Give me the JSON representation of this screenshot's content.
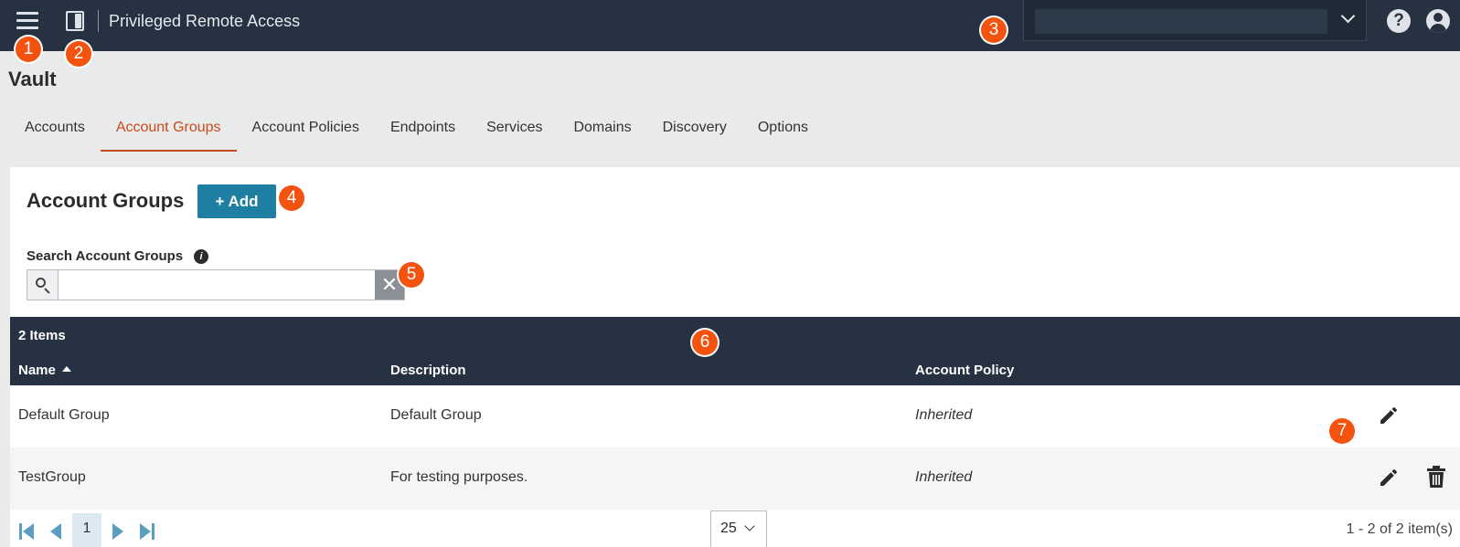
{
  "header": {
    "app_title": "Privileged Remote Access",
    "icons": [
      "hamburger-icon",
      "app-icon",
      "chevron-down-icon",
      "help-icon",
      "user-icon"
    ]
  },
  "page": {
    "title": "Vault"
  },
  "tabs": [
    {
      "label": "Accounts",
      "active": false
    },
    {
      "label": "Account Groups",
      "active": true
    },
    {
      "label": "Account Policies",
      "active": false
    },
    {
      "label": "Endpoints",
      "active": false
    },
    {
      "label": "Services",
      "active": false
    },
    {
      "label": "Domains",
      "active": false
    },
    {
      "label": "Discovery",
      "active": false
    },
    {
      "label": "Options",
      "active": false
    }
  ],
  "panel": {
    "title": "Account Groups",
    "add_label": "+ Add",
    "search_label": "Search Account Groups",
    "search_value": "",
    "clear_symbol": "✕"
  },
  "table": {
    "count_label": "2 Items",
    "columns": [
      "Name",
      "Description",
      "Account Policy"
    ],
    "sorted_column": "Name",
    "rows": [
      {
        "name": "Default Group",
        "description": "Default Group",
        "policy": "Inherited",
        "can_delete": false
      },
      {
        "name": "TestGroup",
        "description": "For testing purposes.",
        "policy": "Inherited",
        "can_delete": true
      }
    ]
  },
  "pager": {
    "current_page": "1",
    "page_size": "25",
    "range_text": "1 - 2 of 2 item(s)"
  },
  "callouts": [
    "1",
    "2",
    "3",
    "4",
    "5",
    "6",
    "7"
  ],
  "colors": {
    "topbar": "#263241",
    "accent_tab": "#c84b1d",
    "add_button": "#1f7fa3",
    "callout": "#f3530f"
  }
}
